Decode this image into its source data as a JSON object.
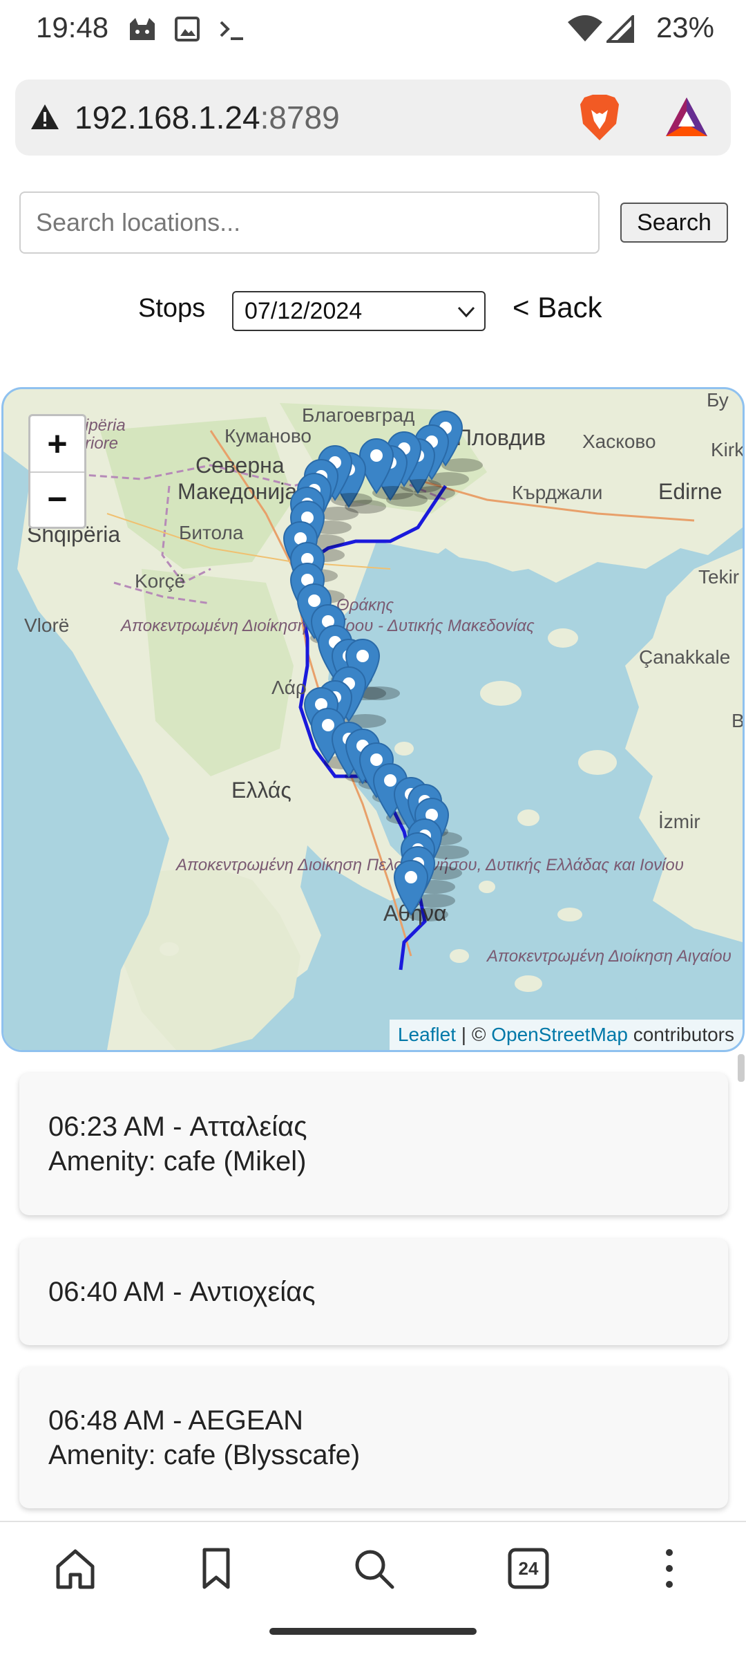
{
  "status_bar": {
    "time": "19:48",
    "battery": "23%",
    "icons": [
      "cat-app-icon",
      "image-icon",
      "terminal-icon",
      "wifi-icon",
      "signal-icon"
    ]
  },
  "browser": {
    "url_host": "192.168.1.24",
    "url_port": ":8789",
    "warning_icon": "warning-icon",
    "brave_icon": "brave-lion-icon",
    "rewards_icon": "bat-triangle-icon"
  },
  "search": {
    "placeholder": "Search locations...",
    "button_label": "Search"
  },
  "stops": {
    "label": "Stops",
    "selected_date": "07/12/2024",
    "back_label": "< Back"
  },
  "map": {
    "zoom_in": "+",
    "zoom_out": "−",
    "attribution_leaflet": "Leaflet",
    "attribution_sep": " | © ",
    "attribution_osm": "OpenStreetMap",
    "attribution_tail": " contributors",
    "labels": {
      "blagoevgrad": "Благоевград",
      "plovdiv": "Пловдив",
      "haskovo": "Хасково",
      "kardzhali": "Кърджали",
      "kirklareli": "Kirklare",
      "edirne": "Edirne",
      "bu": "Бу",
      "kumanovo": "Куманово",
      "severna": "Северна",
      "makedonija": "Македонија",
      "bitola": "Битола",
      "shqiperia": "Shqipëria",
      "shqiperia_top": "ipëria",
      "riore": "riore",
      "korce": "Korçë",
      "vlore": "Vlorë",
      "thrakis": "Θράκης",
      "lar": "Λάρ",
      "ellas": "Ελλάς",
      "athina": "Αθήνα",
      "tekir": "Tekir",
      "canakkale": "Çanakkale",
      "izmir": "İzmir",
      "b": "B",
      "region_epirus": "Αποκεντρωμένη Διοίκηση Ηπείρου - Δυτικής Μακεδονίας",
      "region_pelop": "Αποκεντρωμένη Διοίκηση Πελοποννήσου, Δυτικής Ελλάδας και Ιονίου",
      "region_aegean": "Αποκεντρωμένη Διοίκηση Αιγαίου"
    }
  },
  "stop_cards": [
    {
      "title": "06:23 AM - Ατταλείας",
      "detail": "Amenity: cafe (Mikel)"
    },
    {
      "title": "06:40 AM - Αντιοχείας",
      "detail": ""
    },
    {
      "title": "06:48 AM - AEGEAN",
      "detail": "Amenity: cafe (Blysscafe)"
    }
  ],
  "bottom_nav": {
    "tabs_count": "24",
    "items": [
      "home-icon",
      "bookmark-icon",
      "search-icon",
      "tabs-icon",
      "more-icon"
    ]
  },
  "colors": {
    "route": "#1a1adc",
    "marker": "#3a84c7",
    "map_water": "#aad3df",
    "map_land": "#e9edd9",
    "map_border": "#8fc1ef"
  }
}
